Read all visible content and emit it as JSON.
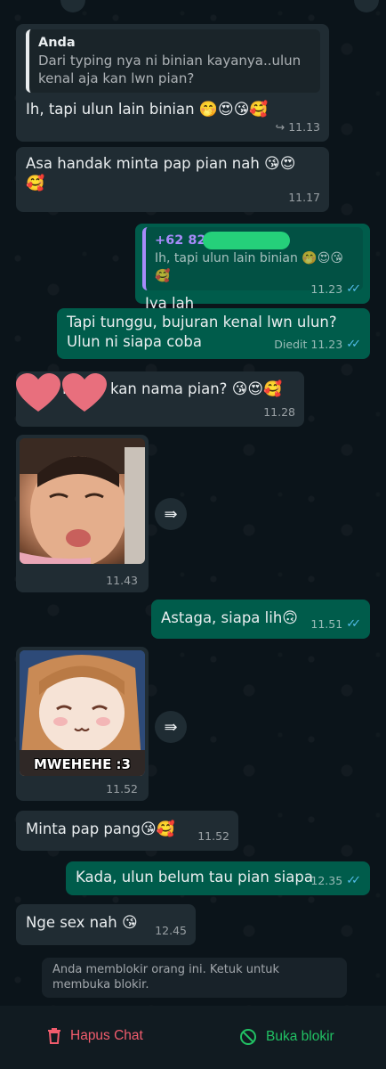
{
  "messages": {
    "m1": {
      "quote_author": "Anda",
      "quote_text": "Dari typing nya ni binian kayanya..ulun kenal aja kan lwn pian?",
      "text": "Ih, tapi ulun lain binian",
      "emoji": "🤭😍😘🥰",
      "time": "11.13",
      "forward_mark": "↪"
    },
    "m2": {
      "text": "Asa handak minta pap pian nah",
      "emoji1": "😘😍",
      "emoji2": "🥰",
      "time": "11.17"
    },
    "m3": {
      "quote_author": "+62 821",
      "quote_text": "Ih, tapi ulun lain binian",
      "quote_emoji": "🤭😍😘🥰",
      "text": "Iya lah",
      "time": "11.23"
    },
    "m4": {
      "line1": "Tapi tunggu, bujuran kenal lwn ulun?",
      "line2": "Ulun ni siapa coba",
      "edited": "Diedit",
      "time": "11.23"
    },
    "m5": {
      "prefix": "R",
      "text": "kan nama pian?",
      "emoji": "😘😍🥰",
      "time": "11.28"
    },
    "m6": {
      "time": "11.43"
    },
    "m7": {
      "text": "Astaga, siapa lih",
      "emoji": "🙃",
      "time": "11.51"
    },
    "m8": {
      "caption": "MWEHEHE :3",
      "time": "11.52"
    },
    "m9": {
      "text": "Minta pap pang",
      "emoji": "😘🥰",
      "time": "11.52"
    },
    "m10": {
      "text": "Kada, ulun belum tau pian siapa",
      "time": "12.35"
    },
    "m11": {
      "text": "Nge sex nah",
      "emoji": "😘",
      "time": "12.45"
    }
  },
  "system_notice": "Anda memblokir orang ini. Ketuk untuk membuka blokir.",
  "actions": {
    "delete_label": "Hapus Chat",
    "unblock_label": "Buka blokir"
  },
  "icons": {
    "forward": "forward-icon",
    "trash": "trash-icon",
    "unblock": "block-icon",
    "read_ticks": "double-check-icon"
  },
  "colors": {
    "incoming": "#202c33",
    "outgoing": "#005c4b",
    "delete": "#f15c6d",
    "unblock": "#21c063",
    "ticks": "#53bdeb"
  }
}
